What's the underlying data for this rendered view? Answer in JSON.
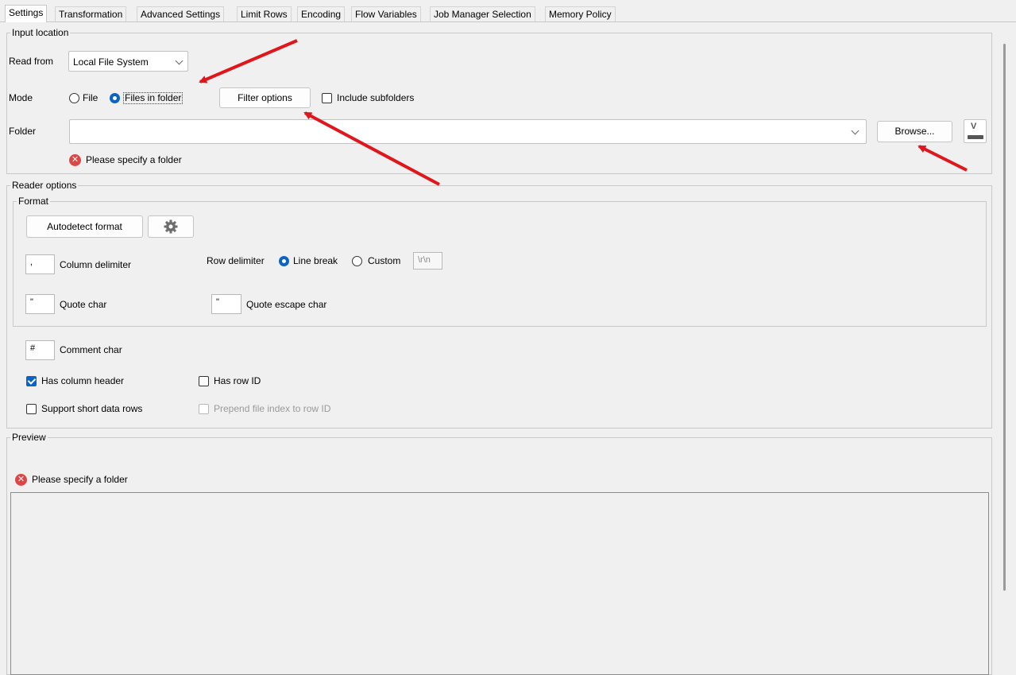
{
  "tabs": [
    "Settings",
    "Transformation",
    "Advanced Settings",
    "Limit Rows",
    "Encoding",
    "Flow Variables",
    "Job Manager Selection",
    "Memory Policy"
  ],
  "input_location": {
    "title": "Input location",
    "read_from_label": "Read from",
    "read_from_value": "Local File System",
    "mode_label": "Mode",
    "mode_file": "File",
    "mode_files_in_folder": "Files in folder",
    "mode_selected": "Files in folder",
    "filter_options": "Filter options",
    "include_subfolders": "Include subfolders",
    "include_subfolders_checked": false,
    "folder_label": "Folder",
    "folder_value": "",
    "browse": "Browse...",
    "error": "Please specify a folder"
  },
  "reader_options": {
    "title": "Reader options",
    "format_title": "Format",
    "autodetect": "Autodetect format",
    "column_delimiter_value": ",",
    "column_delimiter_label": "Column delimiter",
    "row_delimiter_label": "Row delimiter",
    "line_break": "Line break",
    "custom": "Custom",
    "row_delimiter_selected": "Line break",
    "custom_value": "\\r\\n",
    "quote_char_value": "\"",
    "quote_char_label": "Quote char",
    "quote_escape_value": "\"",
    "quote_escape_label": "Quote escape char",
    "comment_char_value": "#",
    "comment_char_label": "Comment char",
    "has_column_header": "Has column header",
    "has_column_header_checked": true,
    "has_row_id": "Has row ID",
    "has_row_id_checked": false,
    "support_short_rows": "Support short data rows",
    "support_short_rows_checked": false,
    "prepend_file_index": "Prepend file index to row ID",
    "prepend_file_index_enabled": false
  },
  "preview": {
    "title": "Preview",
    "error": "Please specify a folder"
  },
  "colors": {
    "accent": "#0a64c6",
    "error": "#e04545",
    "annotation_arrow": "#e0161b"
  }
}
